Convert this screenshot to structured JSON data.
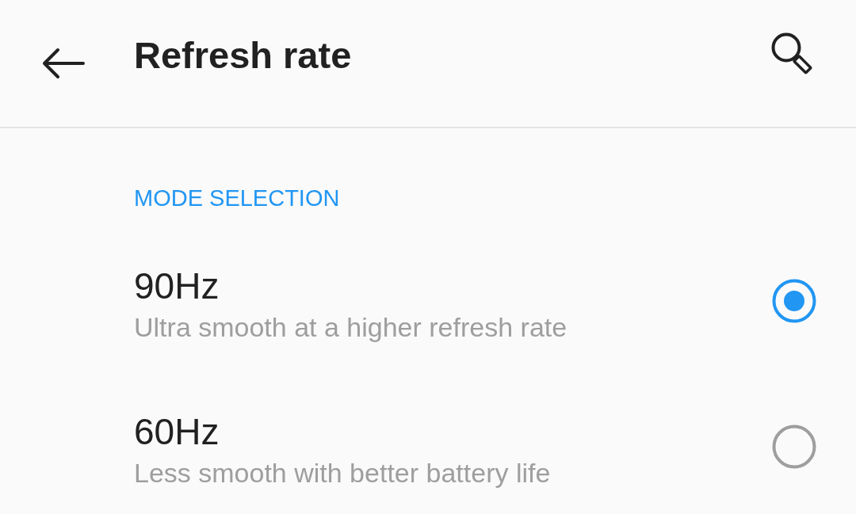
{
  "header": {
    "title": "Refresh rate"
  },
  "section": {
    "title": "MODE SELECTION"
  },
  "options": [
    {
      "title": "90Hz",
      "summary": "Ultra smooth at a higher refresh rate",
      "selected": true
    },
    {
      "title": "60Hz",
      "summary": "Less smooth with better battery life",
      "selected": false
    }
  ]
}
